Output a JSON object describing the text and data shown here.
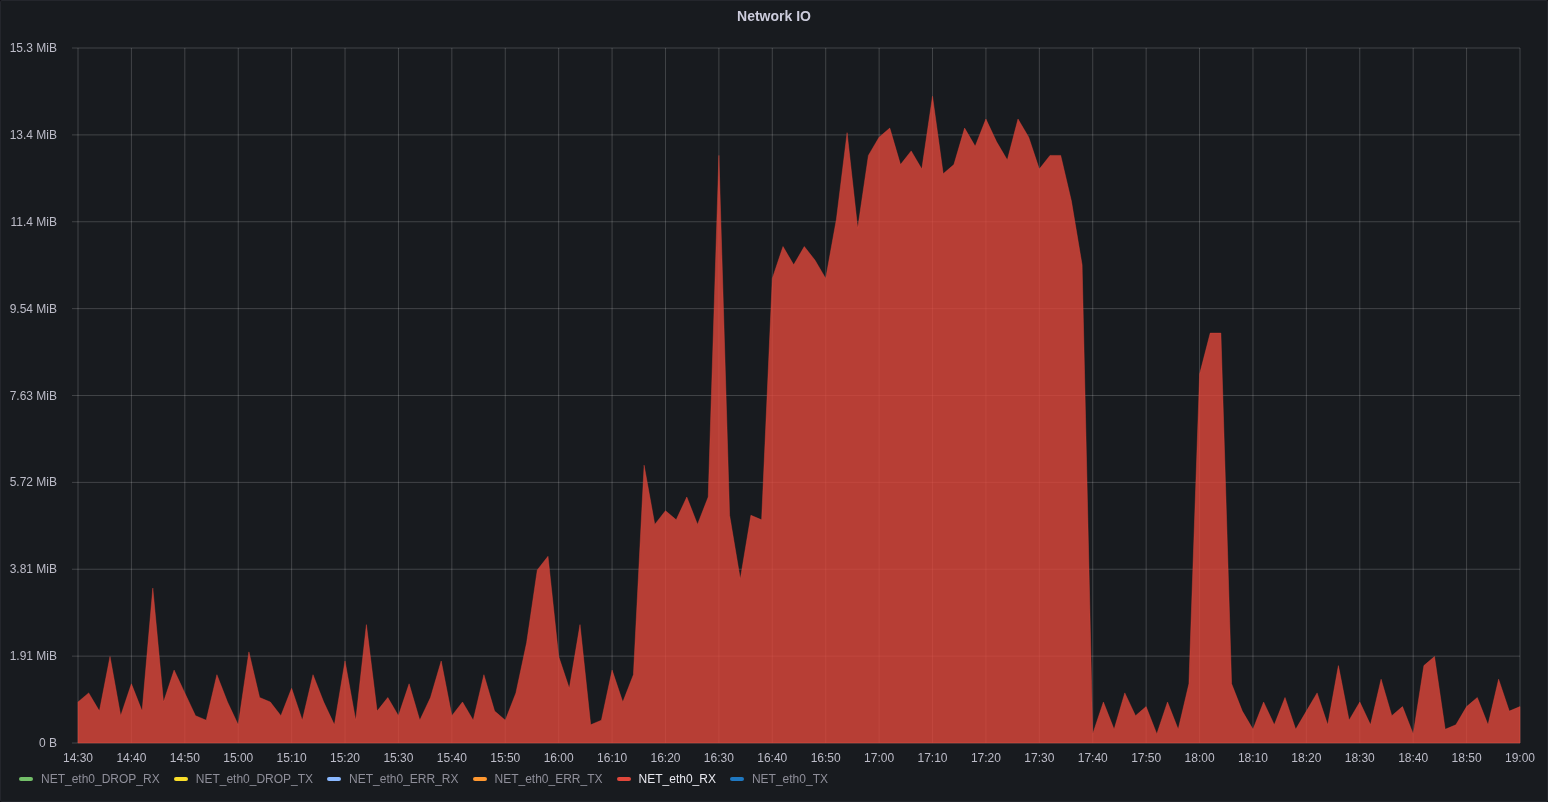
{
  "panel": {
    "title": "Network IO",
    "chart_data": {
      "type": "area",
      "ylim": [
        0,
        15.259
      ],
      "yticks": [
        {
          "value": 0,
          "label": "0 B"
        },
        {
          "value": 1.907,
          "label": "1.91 MiB"
        },
        {
          "value": 3.815,
          "label": "3.81 MiB"
        },
        {
          "value": 5.722,
          "label": "5.72 MiB"
        },
        {
          "value": 7.629,
          "label": "7.63 MiB"
        },
        {
          "value": 9.537,
          "label": "9.54 MiB"
        },
        {
          "value": 11.444,
          "label": "11.4 MiB"
        },
        {
          "value": 13.351,
          "label": "13.4 MiB"
        },
        {
          "value": 15.259,
          "label": "15.3 MiB"
        }
      ],
      "categories": [
        "14:30",
        null,
        null,
        null,
        null,
        "14:40",
        null,
        null,
        null,
        null,
        "14:50",
        null,
        null,
        null,
        null,
        "15:00",
        null,
        null,
        null,
        null,
        "15:10",
        null,
        null,
        null,
        null,
        "15:20",
        null,
        null,
        null,
        null,
        "15:30",
        null,
        null,
        null,
        null,
        "15:40",
        null,
        null,
        null,
        null,
        "15:50",
        null,
        null,
        null,
        null,
        "16:00",
        null,
        null,
        null,
        null,
        "16:10",
        null,
        null,
        null,
        null,
        "16:20",
        null,
        null,
        null,
        null,
        "16:30",
        null,
        null,
        null,
        null,
        "16:40",
        null,
        null,
        null,
        null,
        "16:50",
        null,
        null,
        null,
        null,
        "17:00",
        null,
        null,
        null,
        null,
        "17:10",
        null,
        null,
        null,
        null,
        "17:20",
        null,
        null,
        null,
        null,
        "17:30",
        null,
        null,
        null,
        null,
        "17:40",
        null,
        null,
        null,
        null,
        "17:50",
        null,
        null,
        null,
        null,
        "18:00",
        null,
        null,
        null,
        null,
        "18:10",
        null,
        null,
        null,
        null,
        "18:20",
        null,
        null,
        null,
        null,
        "18:30",
        null,
        null,
        null,
        null,
        "18:40",
        null,
        null,
        null,
        null,
        "18:50",
        null,
        null,
        null,
        null,
        "19:00"
      ],
      "grid": true,
      "series": [
        {
          "name": "NET_eth0_RX",
          "color": "#e0473b",
          "values": [
            0.9,
            1.1,
            0.7,
            1.9,
            0.6,
            1.3,
            0.7,
            3.4,
            0.9,
            1.6,
            1.1,
            0.6,
            0.5,
            1.5,
            0.9,
            0.4,
            2.0,
            1.0,
            0.9,
            0.6,
            1.2,
            0.5,
            1.5,
            0.9,
            0.4,
            1.8,
            0.5,
            2.6,
            0.7,
            1.0,
            0.6,
            1.3,
            0.5,
            1.0,
            1.8,
            0.6,
            0.9,
            0.5,
            1.5,
            0.7,
            0.5,
            1.1,
            2.2,
            3.8,
            4.1,
            1.9,
            1.2,
            2.6,
            0.4,
            0.5,
            1.6,
            0.9,
            1.5,
            6.1,
            4.8,
            5.1,
            4.9,
            5.4,
            4.8,
            5.4,
            12.9,
            5.0,
            3.6,
            5.0,
            4.9,
            10.2,
            10.9,
            10.5,
            10.9,
            10.6,
            10.2,
            11.5,
            13.4,
            11.3,
            12.9,
            13.3,
            13.5,
            12.7,
            13.0,
            12.6,
            14.2,
            12.5,
            12.7,
            13.5,
            13.1,
            13.7,
            13.2,
            12.8,
            13.7,
            13.3,
            12.6,
            12.9,
            12.9,
            11.9,
            10.5,
            0.2,
            0.9,
            0.3,
            1.1,
            0.6,
            0.8,
            0.2,
            0.9,
            0.3,
            1.3,
            8.1,
            9.0,
            9.0,
            1.3,
            0.7,
            0.3,
            0.9,
            0.4,
            1.0,
            0.3,
            0.7,
            1.1,
            0.4,
            1.7,
            0.5,
            0.9,
            0.4,
            1.4,
            0.6,
            0.8,
            0.2,
            1.7,
            1.9,
            0.3,
            0.4,
            0.8,
            1.0,
            0.4,
            1.4,
            0.7,
            0.8
          ]
        }
      ]
    },
    "legend": [
      {
        "kind": "entry",
        "label": "NET_eth0_DROP_RX",
        "color": "#73bf69",
        "selected": false
      },
      {
        "kind": "entry",
        "label": "NET_eth0_DROP_TX",
        "color": "#fade2a",
        "selected": false
      },
      {
        "kind": "entry",
        "label": "NET_eth0_ERR_RX",
        "color": "#8ab8ff",
        "selected": false
      },
      {
        "kind": "entry",
        "label": "NET_eth0_ERR_TX",
        "color": "#ff9830",
        "selected": false
      },
      {
        "kind": "plotted",
        "selected": true
      },
      {
        "kind": "entry",
        "label": "NET_eth0_TX",
        "color": "#1f78c1",
        "selected": false
      }
    ]
  }
}
